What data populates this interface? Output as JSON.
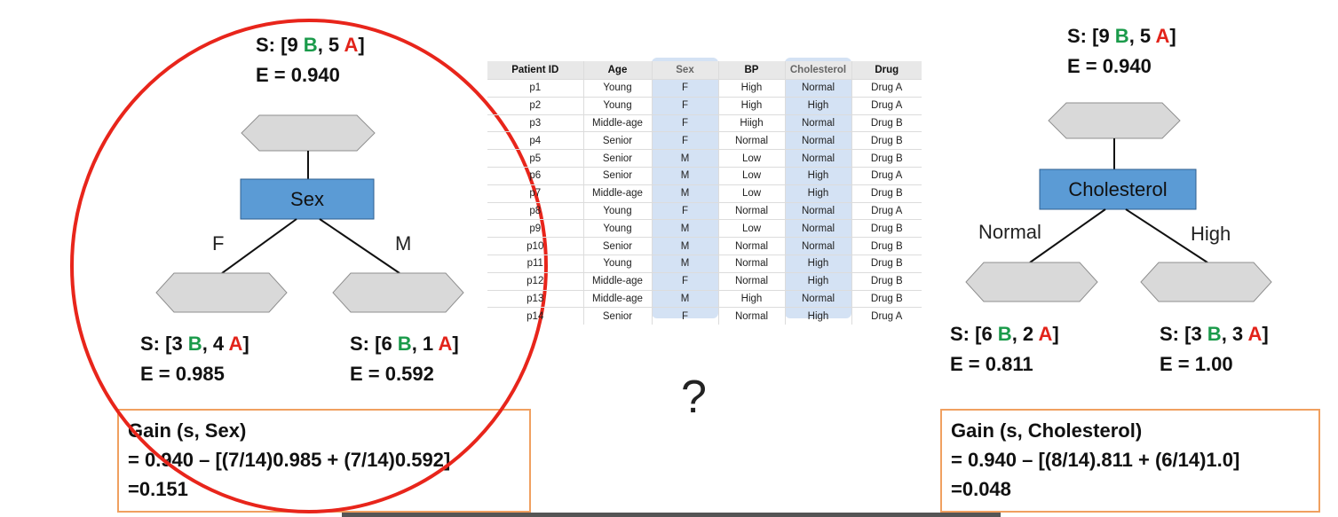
{
  "left_tree": {
    "root": {
      "prefix": "S: [9 ",
      "b": "B",
      "mid": ", 5 ",
      "a": "A",
      "suffix": "]",
      "entropy": "E = 0.940"
    },
    "node_label": "Sex",
    "branch_left": "F",
    "branch_right": "M",
    "left_child": {
      "prefix": "S: [3 ",
      "b": "B",
      "mid": ", 4 ",
      "a": "A",
      "suffix": "]",
      "entropy": "E = 0.985"
    },
    "right_child": {
      "prefix": "S: [6 ",
      "b": "B",
      "mid": ", 1 ",
      "a": "A",
      "suffix": "]",
      "entropy": "E = 0.592"
    },
    "gain": {
      "line1": "Gain (s, Sex)",
      "line2": "= 0.940 – [(7/14)0.985 + (7/14)0.592]",
      "line3": "=0.151"
    }
  },
  "right_tree": {
    "root": {
      "prefix": "S: [9 ",
      "b": "B",
      "mid": ", 5 ",
      "a": "A",
      "suffix": "]",
      "entropy": "E = 0.940"
    },
    "node_label": "Cholesterol",
    "branch_left": "Normal",
    "branch_right": "High",
    "left_child": {
      "prefix": "S: [6 ",
      "b": "B",
      "mid": ", 2 ",
      "a": "A",
      "suffix": "]",
      "entropy": "E = 0.811"
    },
    "right_child": {
      "prefix": "S: [3 ",
      "b": "B",
      "mid": ", 3 ",
      "a": "A",
      "suffix": "]",
      "entropy": "E = 1.00"
    },
    "gain": {
      "line1": "Gain (s, Cholesterol)",
      "line2": "= 0.940 – [(8/14).811 + (6/14)1.0]",
      "line3": "=0.048"
    }
  },
  "question_mark": "?",
  "colors": {
    "node_fill": "#5b9bd5",
    "hexagon_fill": "#d9d9d9",
    "green": "#1a9a4a",
    "red": "#e2231a",
    "circle": "#e8251b",
    "box_border": "#f0a060"
  },
  "table": {
    "headers": [
      "Patient ID",
      "Age",
      "Sex",
      "BP",
      "Cholesterol",
      "Drug"
    ],
    "rows": [
      [
        "p1",
        "Young",
        "F",
        "High",
        "Normal",
        "Drug A"
      ],
      [
        "p2",
        "Young",
        "F",
        "High",
        "High",
        "Drug A"
      ],
      [
        "p3",
        "Middle-age",
        "F",
        "Hiigh",
        "Normal",
        "Drug B"
      ],
      [
        "p4",
        "Senior",
        "F",
        "Normal",
        "Normal",
        "Drug B"
      ],
      [
        "p5",
        "Senior",
        "M",
        "Low",
        "Normal",
        "Drug B"
      ],
      [
        "p6",
        "Senior",
        "M",
        "Low",
        "High",
        "Drug A"
      ],
      [
        "p7",
        "Middle-age",
        "M",
        "Low",
        "High",
        "Drug B"
      ],
      [
        "p8",
        "Young",
        "F",
        "Normal",
        "Normal",
        "Drug A"
      ],
      [
        "p9",
        "Young",
        "M",
        "Low",
        "Normal",
        "Drug B"
      ],
      [
        "p10",
        "Senior",
        "M",
        "Normal",
        "Normal",
        "Drug B"
      ],
      [
        "p11",
        "Young",
        "M",
        "Normal",
        "High",
        "Drug B"
      ],
      [
        "p12",
        "Middle-age",
        "F",
        "Normal",
        "High",
        "Drug B"
      ],
      [
        "p13",
        "Middle-age",
        "M",
        "High",
        "Normal",
        "Drug B"
      ],
      [
        "p14",
        "Senior",
        "F",
        "Normal",
        "High",
        "Drug A"
      ]
    ]
  }
}
